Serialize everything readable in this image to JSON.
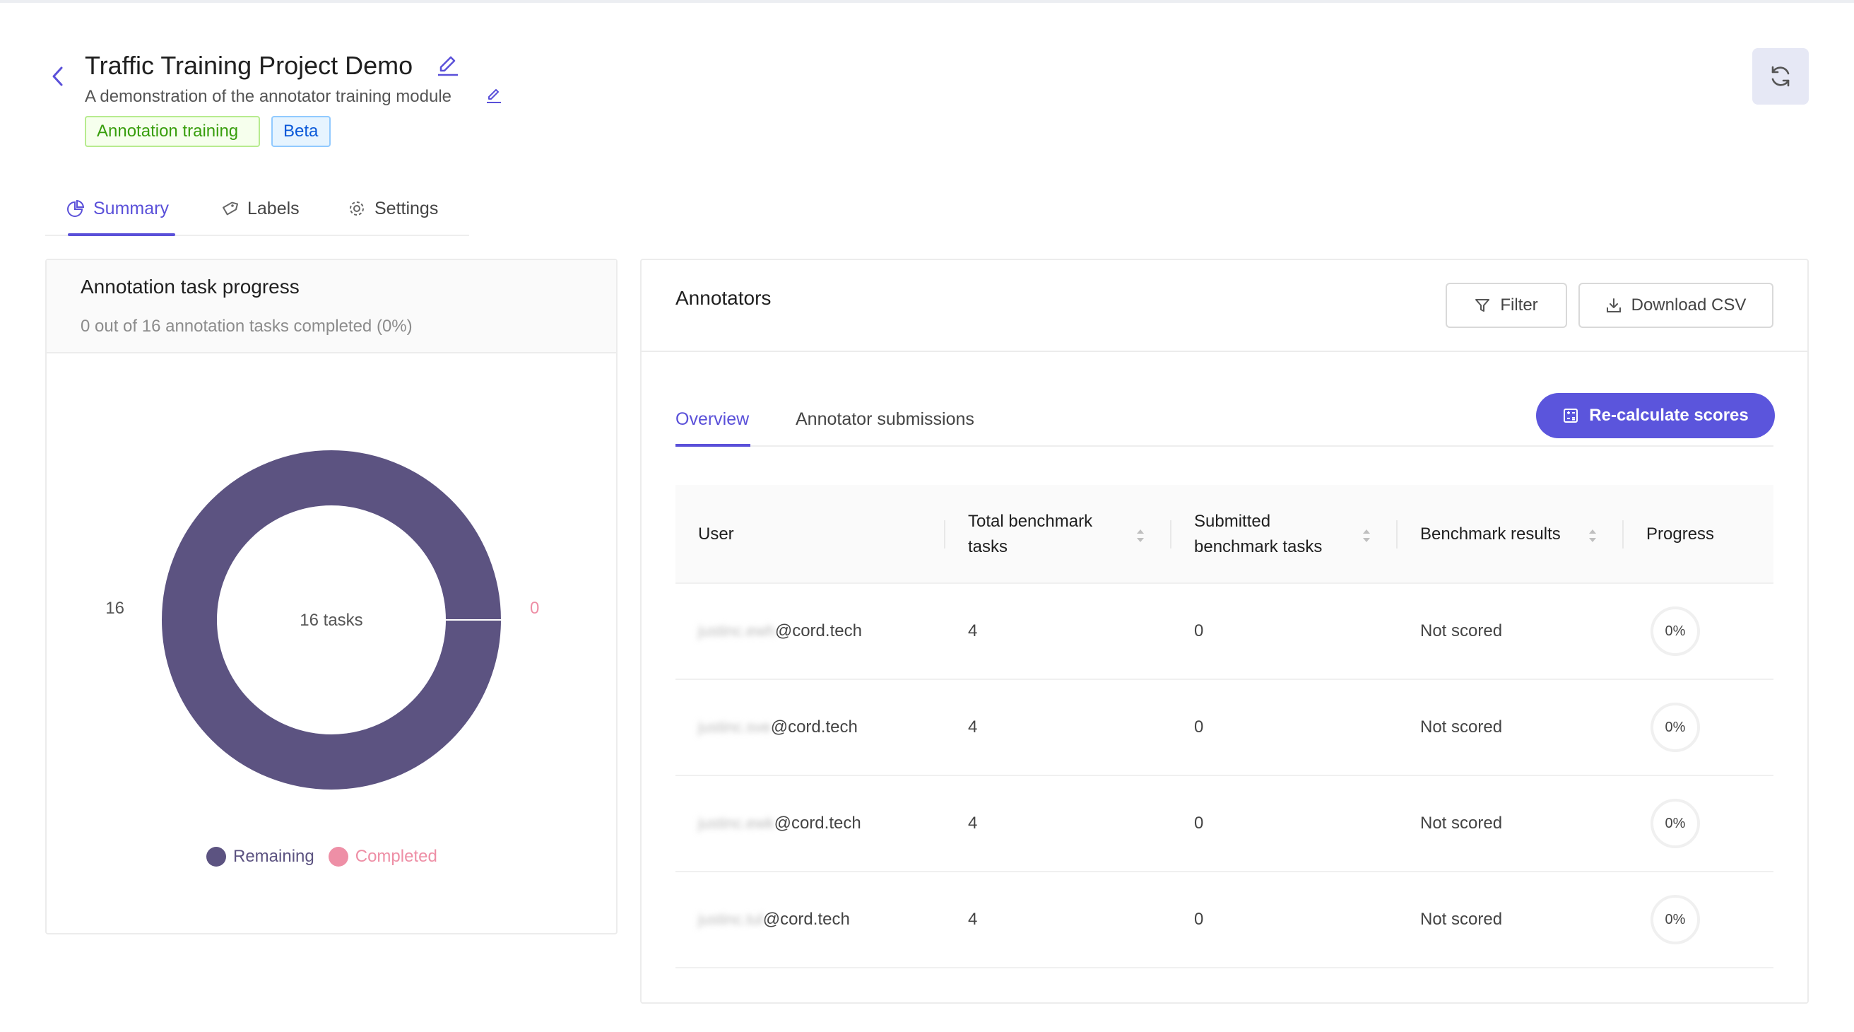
{
  "header": {
    "title": "Traffic Training Project Demo",
    "subtitle": "A demonstration of the annotator training module",
    "tags": [
      "Annotation training",
      "Beta"
    ]
  },
  "tabs": [
    {
      "label": "Summary",
      "icon": "pie-chart-icon",
      "active": true
    },
    {
      "label": "Labels",
      "icon": "tag-icon"
    },
    {
      "label": "Settings",
      "icon": "gear-icon"
    }
  ],
  "progress": {
    "title": "Annotation task progress",
    "summary": "0 out of 16 annotation tasks completed (0%)",
    "center_label": "16 tasks",
    "remaining_count": "16",
    "completed_count": "0",
    "legend": {
      "remaining": "Remaining",
      "completed": "Completed"
    }
  },
  "colors": {
    "accent": "#5a50d9",
    "remaining": "#5c5381",
    "completed": "#ee8fa6"
  },
  "chart_data": {
    "type": "pie",
    "categories": [
      "Remaining",
      "Completed"
    ],
    "values": [
      16,
      0
    ]
  },
  "annotators": {
    "title": "Annotators",
    "filter_label": "Filter",
    "download_label": "Download CSV",
    "subtabs": [
      "Overview",
      "Annotator submissions"
    ],
    "recalc_label": "Re-calculate scores",
    "columns": [
      "User",
      "Total benchmark tasks",
      "Submitted benchmark tasks",
      "Benchmark results",
      "Progress"
    ],
    "rows": [
      {
        "user_hidden": "justinc.ewh",
        "domain": "@cord.tech",
        "total": "4",
        "submitted": "0",
        "result": "Not scored",
        "progress": "0%"
      },
      {
        "user_hidden": "justinc.sve",
        "domain": "@cord.tech",
        "total": "4",
        "submitted": "0",
        "result": "Not scored",
        "progress": "0%"
      },
      {
        "user_hidden": "justinc.ewk",
        "domain": "@cord.tech",
        "total": "4",
        "submitted": "0",
        "result": "Not scored",
        "progress": "0%"
      },
      {
        "user_hidden": "justinc.tul",
        "domain": "@cord.tech",
        "total": "4",
        "submitted": "0",
        "result": "Not scored",
        "progress": "0%"
      }
    ]
  }
}
